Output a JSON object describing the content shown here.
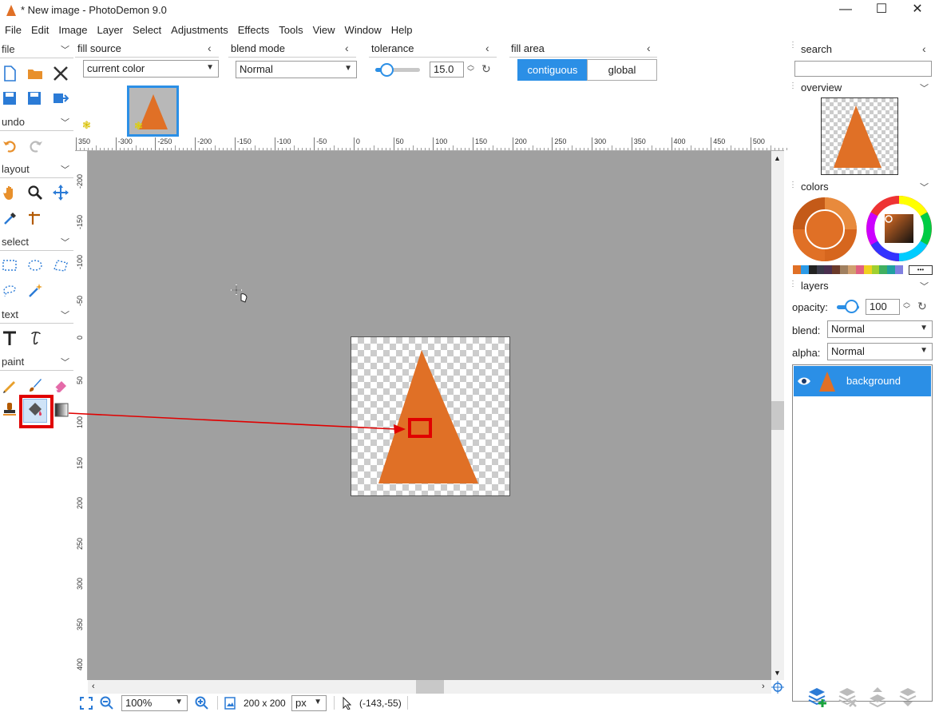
{
  "window": {
    "title": "* New image  -  PhotoDemon 9.0",
    "minimize": "—",
    "maximize": "☐",
    "close": "✕"
  },
  "menu": [
    "File",
    "Edit",
    "Image",
    "Layer",
    "Select",
    "Adjustments",
    "Effects",
    "Tools",
    "View",
    "Window",
    "Help"
  ],
  "left_panel": {
    "sections": {
      "file": "file",
      "undo": "undo",
      "layout": "layout",
      "select": "select",
      "text": "text",
      "paint": "paint"
    }
  },
  "options": {
    "fill_source": {
      "header": "fill source",
      "value": "current color"
    },
    "blend_mode": {
      "header": "blend mode",
      "value": "Normal"
    },
    "tolerance": {
      "header": "tolerance",
      "value": "15.0",
      "level": 0.15
    },
    "fill_area": {
      "header": "fill area",
      "contiguous": "contiguous",
      "global": "global",
      "selected": "contiguous"
    }
  },
  "rulers": {
    "top": [
      "350",
      "-300",
      "-250",
      "-200",
      "-150",
      "-100",
      "-50",
      "0",
      "50",
      "100",
      "150",
      "200",
      "250",
      "300",
      "350",
      "400",
      "450",
      "500"
    ],
    "left": [
      "-200",
      "-150",
      "-100",
      "-50",
      "0",
      "50",
      "100",
      "150",
      "200",
      "250",
      "300",
      "350",
      "400"
    ]
  },
  "statusbar": {
    "zoom": "100%",
    "size": "200 x 200",
    "unit": "px",
    "coords": "(-143,-55)"
  },
  "right_panel": {
    "search": {
      "header": "search",
      "placeholder": ""
    },
    "overview": {
      "header": "overview"
    },
    "colors": {
      "header": "colors",
      "more": "•••"
    },
    "layers": {
      "header": "layers",
      "opacity_label": "opacity:",
      "opacity_value": "100",
      "blend_label": "blend:",
      "blend_value": "Normal",
      "alpha_label": "alpha:",
      "alpha_value": "Normal",
      "items": [
        {
          "name": "background"
        }
      ]
    }
  },
  "colors": {
    "accent": "#2b8fe6",
    "shape": "#e07026",
    "canvas_bg": "#a0a0a0",
    "highlight": "#e00000"
  }
}
